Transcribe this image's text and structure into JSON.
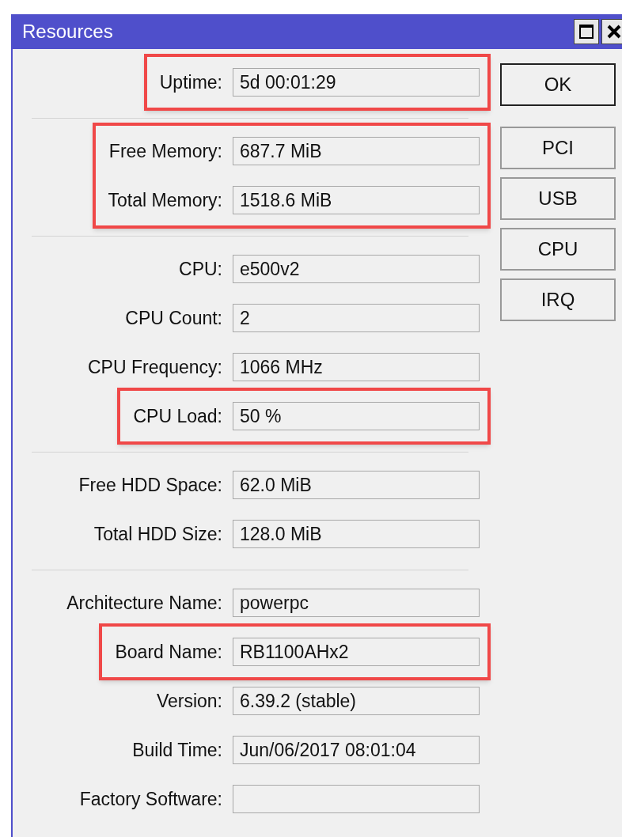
{
  "window": {
    "title": "Resources"
  },
  "title_buttons": [
    {
      "kind": "maximize"
    },
    {
      "kind": "close"
    }
  ],
  "groups": [
    {
      "rows": [
        {
          "label": "Uptime:",
          "value": "5d 00:01:29",
          "highlighted": true
        }
      ]
    },
    {
      "rows": [
        {
          "label": "Free Memory:",
          "value": "687.7 MiB",
          "highlighted": true
        },
        {
          "label": "Total Memory:",
          "value": "1518.6 MiB",
          "highlighted": true
        }
      ]
    },
    {
      "rows": [
        {
          "label": "CPU:",
          "value": "e500v2",
          "highlighted": false
        },
        {
          "label": "CPU Count:",
          "value": "2",
          "highlighted": false
        },
        {
          "label": "CPU Frequency:",
          "value": "1066 MHz",
          "highlighted": false
        },
        {
          "label": "CPU Load:",
          "value": "50 %",
          "highlighted": true
        }
      ]
    },
    {
      "rows": [
        {
          "label": "Free HDD Space:",
          "value": "62.0 MiB",
          "highlighted": false
        },
        {
          "label": "Total HDD Size:",
          "value": "128.0 MiB",
          "highlighted": false
        }
      ]
    },
    {
      "rows": [
        {
          "label": "Architecture Name:",
          "value": "powerpc",
          "highlighted": false
        },
        {
          "label": "Board Name:",
          "value": "RB1100AHx2",
          "highlighted": true
        },
        {
          "label": "Version:",
          "value": "6.39.2 (stable)",
          "highlighted": false
        },
        {
          "label": "Build Time:",
          "value": "Jun/06/2017 08:01:04",
          "highlighted": false
        },
        {
          "label": "Factory Software:",
          "value": "",
          "highlighted": false
        }
      ]
    }
  ],
  "buttons": [
    {
      "label": "OK",
      "default": true
    },
    {
      "label": "PCI",
      "default": false
    },
    {
      "label": "USB",
      "default": false
    },
    {
      "label": "CPU",
      "default": false
    },
    {
      "label": "IRQ",
      "default": false
    }
  ]
}
